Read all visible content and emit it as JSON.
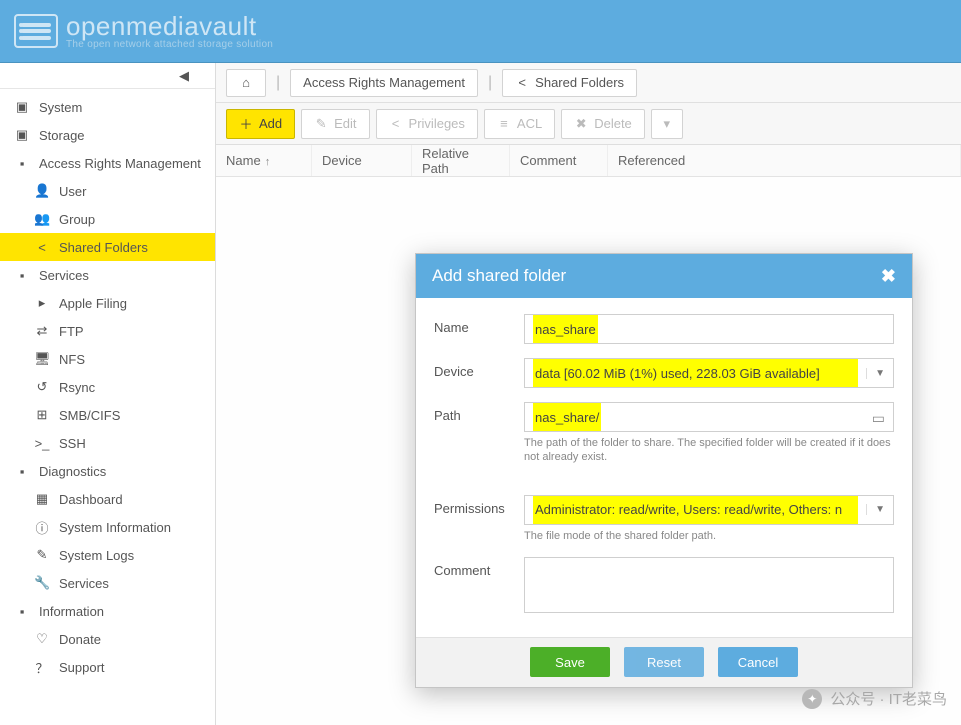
{
  "brand": {
    "name": "openmediavault",
    "tagline": "The open network attached storage solution"
  },
  "breadcrumbs": {
    "home_icon": "home-icon",
    "item1": "Access Rights Management",
    "item2_icon": "share-icon",
    "item2": "Shared Folders"
  },
  "toolbar": {
    "add": "Add",
    "edit": "Edit",
    "privileges": "Privileges",
    "acl": "ACL",
    "delete": "Delete"
  },
  "grid": {
    "columns": {
      "name": "Name",
      "device": "Device",
      "relpath": "Relative Path",
      "comment": "Comment",
      "referenced": "Referenced"
    }
  },
  "sidebar": {
    "items": [
      {
        "label": "System",
        "icon": "plus-square-icon",
        "level": 1
      },
      {
        "label": "Storage",
        "icon": "plus-square-icon",
        "level": 1
      },
      {
        "label": "Access Rights Management",
        "icon": "minus-square-icon",
        "level": 1
      },
      {
        "label": "User",
        "icon": "user-icon",
        "level": 2
      },
      {
        "label": "Group",
        "icon": "users-icon",
        "level": 2
      },
      {
        "label": "Shared Folders",
        "icon": "share-icon",
        "level": 2,
        "active": true
      },
      {
        "label": "Services",
        "icon": "minus-square-icon",
        "level": 1
      },
      {
        "label": "Apple Filing",
        "icon": "apple-icon",
        "level": 2
      },
      {
        "label": "FTP",
        "icon": "ftp-icon",
        "level": 2
      },
      {
        "label": "NFS",
        "icon": "nfs-icon",
        "level": 2
      },
      {
        "label": "Rsync",
        "icon": "rsync-icon",
        "level": 2
      },
      {
        "label": "SMB/CIFS",
        "icon": "windows-icon",
        "level": 2
      },
      {
        "label": "SSH",
        "icon": "terminal-icon",
        "level": 2
      },
      {
        "label": "Diagnostics",
        "icon": "minus-square-icon",
        "level": 1
      },
      {
        "label": "Dashboard",
        "icon": "dashboard-icon",
        "level": 2
      },
      {
        "label": "System Information",
        "icon": "info-icon",
        "level": 2
      },
      {
        "label": "System Logs",
        "icon": "logs-icon",
        "level": 2
      },
      {
        "label": "Services",
        "icon": "wrench-icon",
        "level": 2
      },
      {
        "label": "Information",
        "icon": "minus-square-icon",
        "level": 1
      },
      {
        "label": "Donate",
        "icon": "heart-icon",
        "level": 2
      },
      {
        "label": "Support",
        "icon": "question-icon",
        "level": 2
      }
    ]
  },
  "dialog": {
    "title": "Add shared folder",
    "fields": {
      "name": {
        "label": "Name",
        "value": "nas_share"
      },
      "device": {
        "label": "Device",
        "value": "data [60.02 MiB (1%) used, 228.03 GiB available]"
      },
      "path": {
        "label": "Path",
        "value": "nas_share/",
        "help": "The path of the folder to share. The specified folder will be created if it does not already exist."
      },
      "permissions": {
        "label": "Permissions",
        "value": "Administrator: read/write, Users: read/write, Others: n",
        "help": "The file mode of the shared folder path."
      },
      "comment": {
        "label": "Comment",
        "value": ""
      }
    },
    "buttons": {
      "save": "Save",
      "reset": "Reset",
      "cancel": "Cancel"
    }
  },
  "watermark": {
    "text": "公众号 · IT老菜鸟"
  }
}
